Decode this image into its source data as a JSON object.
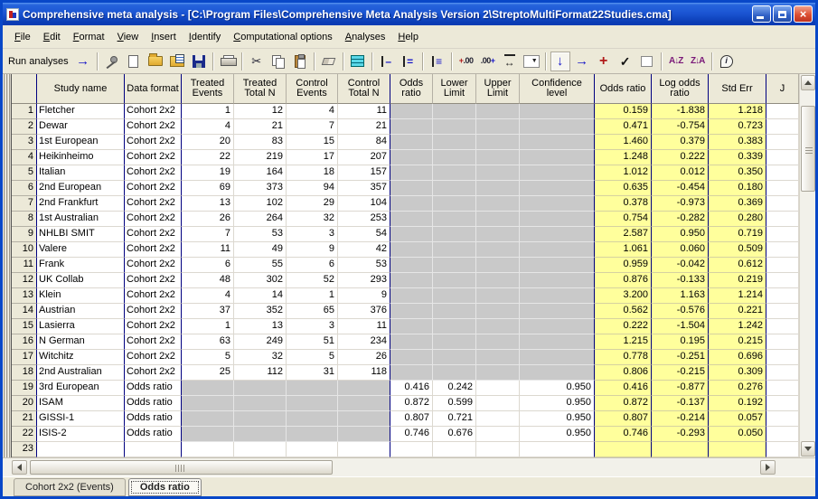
{
  "window": {
    "title": "Comprehensive meta analysis - [C:\\Program Files\\Comprehensive Meta Analysis Version 2\\StreptoMultiFormat22Studies.cma]",
    "controls": [
      "minimize",
      "maximize",
      "close"
    ]
  },
  "menu": {
    "items": [
      "File",
      "Edit",
      "Format",
      "View",
      "Insert",
      "Identify",
      "Computational options",
      "Analyses",
      "Help"
    ]
  },
  "toolbar": {
    "run_label": "Run analyses",
    "items": [
      {
        "label": "Run analyses"
      },
      {
        "name": "run-arrow-icon",
        "glyph": "→"
      },
      {
        "sep": 1
      },
      {
        "name": "pushpin-icon"
      },
      {
        "name": "new-document-icon"
      },
      {
        "name": "open-folder-icon"
      },
      {
        "name": "import-sheet-icon"
      },
      {
        "name": "save-icon"
      },
      {
        "sep": 1
      },
      {
        "name": "print-icon"
      },
      {
        "sep": 1
      },
      {
        "name": "cut-icon",
        "glyph": "✂"
      },
      {
        "name": "copy-icon"
      },
      {
        "name": "paste-icon"
      },
      {
        "sep": 1
      },
      {
        "name": "eraser-icon"
      },
      {
        "sep": 1
      },
      {
        "name": "data-sheet-icon"
      },
      {
        "sep": 1
      },
      {
        "name": "insert-row-before-icon",
        "glyph": "–"
      },
      {
        "name": "insert-row-after-icon",
        "glyph": "="
      },
      {
        "sep": 1
      },
      {
        "name": "insert-blank-rows-icon",
        "glyph": "≡"
      },
      {
        "sep": 1
      },
      {
        "name": "increase-decimals-icon",
        "glyph": ".00"
      },
      {
        "name": "decrease-decimals-icon",
        "glyph": ".00"
      },
      {
        "name": "column-width-icon",
        "glyph": "↔"
      },
      {
        "name": "dropdown-combo-icon",
        "glyph": "▼"
      },
      {
        "sep": 1
      },
      {
        "name": "arrow-down-icon",
        "glyph": "↓",
        "pressed": true
      },
      {
        "name": "arrow-right-icon",
        "glyph": "→"
      },
      {
        "name": "plus-icon",
        "glyph": "+"
      },
      {
        "name": "check-icon",
        "glyph": "✓"
      },
      {
        "name": "empty-box-icon"
      },
      {
        "sep": 1
      },
      {
        "name": "sort-ascending-icon",
        "glyph": "A↓Z"
      },
      {
        "name": "sort-descending-icon",
        "glyph": "Z↓A"
      },
      {
        "sep": 1
      },
      {
        "name": "info-icon",
        "glyph": "i"
      }
    ]
  },
  "grid": {
    "columns": [
      "",
      "Study name",
      "Data format",
      "Treated Events",
      "Treated Total N",
      "Control Events",
      "Control Total N",
      "Odds ratio",
      "Lower Limit",
      "Upper Limit",
      "Confidence level",
      "Odds ratio",
      "Log odds ratio",
      "Std Err",
      "J"
    ],
    "rows": [
      {
        "n": "1",
        "study": "Fletcher",
        "fmt": "Cohort 2x2",
        "te": "1",
        "ttn": "12",
        "ce": "4",
        "ctn": "11",
        "or": "",
        "ll": "",
        "ul": "",
        "cl": "",
        "yor": "0.159",
        "ylog": "-1.838",
        "ystd": "1.218"
      },
      {
        "n": "2",
        "study": "Dewar",
        "fmt": "Cohort 2x2",
        "te": "4",
        "ttn": "21",
        "ce": "7",
        "ctn": "21",
        "or": "",
        "ll": "",
        "ul": "",
        "cl": "",
        "yor": "0.471",
        "ylog": "-0.754",
        "ystd": "0.723"
      },
      {
        "n": "3",
        "study": "1st European",
        "fmt": "Cohort 2x2",
        "te": "20",
        "ttn": "83",
        "ce": "15",
        "ctn": "84",
        "or": "",
        "ll": "",
        "ul": "",
        "cl": "",
        "yor": "1.460",
        "ylog": "0.379",
        "ystd": "0.383"
      },
      {
        "n": "4",
        "study": "Heikinheimo",
        "fmt": "Cohort 2x2",
        "te": "22",
        "ttn": "219",
        "ce": "17",
        "ctn": "207",
        "or": "",
        "ll": "",
        "ul": "",
        "cl": "",
        "yor": "1.248",
        "ylog": "0.222",
        "ystd": "0.339"
      },
      {
        "n": "5",
        "study": "Italian",
        "fmt": "Cohort 2x2",
        "te": "19",
        "ttn": "164",
        "ce": "18",
        "ctn": "157",
        "or": "",
        "ll": "",
        "ul": "",
        "cl": "",
        "yor": "1.012",
        "ylog": "0.012",
        "ystd": "0.350"
      },
      {
        "n": "6",
        "study": "2nd European",
        "fmt": "Cohort 2x2",
        "te": "69",
        "ttn": "373",
        "ce": "94",
        "ctn": "357",
        "or": "",
        "ll": "",
        "ul": "",
        "cl": "",
        "yor": "0.635",
        "ylog": "-0.454",
        "ystd": "0.180"
      },
      {
        "n": "7",
        "study": "2nd Frankfurt",
        "fmt": "Cohort 2x2",
        "te": "13",
        "ttn": "102",
        "ce": "29",
        "ctn": "104",
        "or": "",
        "ll": "",
        "ul": "",
        "cl": "",
        "yor": "0.378",
        "ylog": "-0.973",
        "ystd": "0.369"
      },
      {
        "n": "8",
        "study": "1st Australian",
        "fmt": "Cohort 2x2",
        "te": "26",
        "ttn": "264",
        "ce": "32",
        "ctn": "253",
        "or": "",
        "ll": "",
        "ul": "",
        "cl": "",
        "yor": "0.754",
        "ylog": "-0.282",
        "ystd": "0.280"
      },
      {
        "n": "9",
        "study": "NHLBI SMIT",
        "fmt": "Cohort 2x2",
        "te": "7",
        "ttn": "53",
        "ce": "3",
        "ctn": "54",
        "or": "",
        "ll": "",
        "ul": "",
        "cl": "",
        "yor": "2.587",
        "ylog": "0.950",
        "ystd": "0.719"
      },
      {
        "n": "10",
        "study": "Valere",
        "fmt": "Cohort 2x2",
        "te": "11",
        "ttn": "49",
        "ce": "9",
        "ctn": "42",
        "or": "",
        "ll": "",
        "ul": "",
        "cl": "",
        "yor": "1.061",
        "ylog": "0.060",
        "ystd": "0.509"
      },
      {
        "n": "11",
        "study": "Frank",
        "fmt": "Cohort 2x2",
        "te": "6",
        "ttn": "55",
        "ce": "6",
        "ctn": "53",
        "or": "",
        "ll": "",
        "ul": "",
        "cl": "",
        "yor": "0.959",
        "ylog": "-0.042",
        "ystd": "0.612"
      },
      {
        "n": "12",
        "study": "UK Collab",
        "fmt": "Cohort 2x2",
        "te": "48",
        "ttn": "302",
        "ce": "52",
        "ctn": "293",
        "or": "",
        "ll": "",
        "ul": "",
        "cl": "",
        "yor": "0.876",
        "ylog": "-0.133",
        "ystd": "0.219"
      },
      {
        "n": "13",
        "study": "Klein",
        "fmt": "Cohort 2x2",
        "te": "4",
        "ttn": "14",
        "ce": "1",
        "ctn": "9",
        "or": "",
        "ll": "",
        "ul": "",
        "cl": "",
        "yor": "3.200",
        "ylog": "1.163",
        "ystd": "1.214"
      },
      {
        "n": "14",
        "study": "Austrian",
        "fmt": "Cohort 2x2",
        "te": "37",
        "ttn": "352",
        "ce": "65",
        "ctn": "376",
        "or": "",
        "ll": "",
        "ul": "",
        "cl": "",
        "yor": "0.562",
        "ylog": "-0.576",
        "ystd": "0.221"
      },
      {
        "n": "15",
        "study": "Lasierra",
        "fmt": "Cohort 2x2",
        "te": "1",
        "ttn": "13",
        "ce": "3",
        "ctn": "11",
        "or": "",
        "ll": "",
        "ul": "",
        "cl": "",
        "yor": "0.222",
        "ylog": "-1.504",
        "ystd": "1.242"
      },
      {
        "n": "16",
        "study": "N German",
        "fmt": "Cohort 2x2",
        "te": "63",
        "ttn": "249",
        "ce": "51",
        "ctn": "234",
        "or": "",
        "ll": "",
        "ul": "",
        "cl": "",
        "yor": "1.215",
        "ylog": "0.195",
        "ystd": "0.215"
      },
      {
        "n": "17",
        "study": "Witchitz",
        "fmt": "Cohort 2x2",
        "te": "5",
        "ttn": "32",
        "ce": "5",
        "ctn": "26",
        "or": "",
        "ll": "",
        "ul": "",
        "cl": "",
        "yor": "0.778",
        "ylog": "-0.251",
        "ystd": "0.696"
      },
      {
        "n": "18",
        "study": "2nd Australian",
        "fmt": "Cohort 2x2",
        "te": "25",
        "ttn": "112",
        "ce": "31",
        "ctn": "118",
        "or": "",
        "ll": "",
        "ul": "",
        "cl": "",
        "yor": "0.806",
        "ylog": "-0.215",
        "ystd": "0.309"
      },
      {
        "n": "19",
        "study": "3rd European",
        "fmt": "Odds ratio",
        "te": "",
        "ttn": "",
        "ce": "",
        "ctn": "",
        "or": "0.416",
        "ll": "0.242",
        "ul": "",
        "cl": "0.950",
        "yor": "0.416",
        "ylog": "-0.877",
        "ystd": "0.276"
      },
      {
        "n": "20",
        "study": "ISAM",
        "fmt": "Odds ratio",
        "te": "",
        "ttn": "",
        "ce": "",
        "ctn": "",
        "or": "0.872",
        "ll": "0.599",
        "ul": "",
        "cl": "0.950",
        "yor": "0.872",
        "ylog": "-0.137",
        "ystd": "0.192"
      },
      {
        "n": "21",
        "study": "GISSI-1",
        "fmt": "Odds ratio",
        "te": "",
        "ttn": "",
        "ce": "",
        "ctn": "",
        "or": "0.807",
        "ll": "0.721",
        "ul": "",
        "cl": "0.950",
        "yor": "0.807",
        "ylog": "-0.214",
        "ystd": "0.057"
      },
      {
        "n": "22",
        "study": "ISIS-2",
        "fmt": "Odds ratio",
        "te": "",
        "ttn": "",
        "ce": "",
        "ctn": "",
        "or": "0.746",
        "ll": "0.676",
        "ul": "",
        "cl": "0.950",
        "yor": "0.746",
        "ylog": "-0.293",
        "ystd": "0.050"
      },
      {
        "n": "23",
        "study": "",
        "fmt": "",
        "te": "",
        "ttn": "",
        "ce": "",
        "ctn": "",
        "or": "",
        "ll": "",
        "ul": "",
        "cl": "",
        "yor": "",
        "ylog": "",
        "ystd": ""
      }
    ]
  },
  "tabs": [
    {
      "label": "Cohort 2x2 (Events)",
      "active": false
    },
    {
      "label": "Odds ratio",
      "active": true
    }
  ],
  "colors": {
    "computed_column_yellow": "#FFFF9C",
    "disabled_cell_gray": "#C9C9C9",
    "group_border_navy": "#000080",
    "titlebar_blue": "#1B55D3",
    "chrome_beige": "#ECE9D8"
  }
}
